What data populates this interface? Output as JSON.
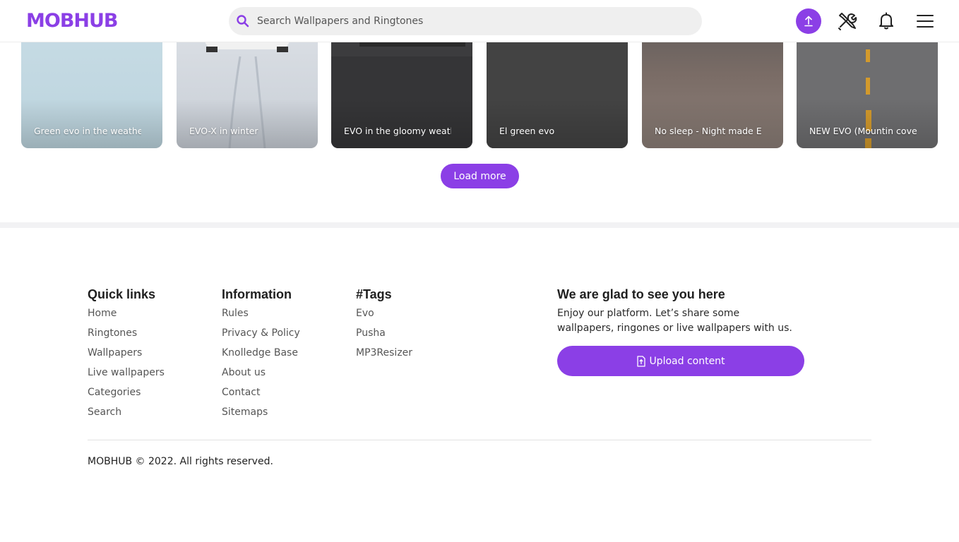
{
  "header": {
    "logo": "MOBHUB",
    "search_placeholder": "Search Wallpapers and Ringtones",
    "icons": [
      "search-icon",
      "upload-icon",
      "tools-icon",
      "bell-icon",
      "menu-icon"
    ]
  },
  "cards": [
    {
      "title": "Green evo in the weather"
    },
    {
      "title": "EVO-X in winter"
    },
    {
      "title": "EVO in the gloomy weather"
    },
    {
      "title": "El green evo"
    },
    {
      "title": "No sleep - Night made EVO"
    },
    {
      "title": "NEW EVO (Mountin cover)"
    }
  ],
  "load_more": "Load more",
  "footer": {
    "quick_links": {
      "heading": "Quick links",
      "items": [
        "Home",
        "Ringtones",
        "Wallpapers",
        "Live wallpapers",
        "Categories",
        "Search"
      ]
    },
    "information": {
      "heading": "Information",
      "items": [
        "Rules",
        "Privacy & Policy",
        "Knolledge Base",
        "About us",
        "Contact",
        "Sitemaps"
      ]
    },
    "tags": {
      "heading": "#Tags",
      "items": [
        "Evo",
        "Pusha",
        "MP3Resizer"
      ]
    },
    "glad": {
      "heading": "We are glad to see you here",
      "text": "Enjoy our platform. Let’s share some wallpapers, ringones or live wallpapers with us.",
      "button": "Upload content"
    },
    "copyright": "MOBHUB © 2022. All rights reserved."
  },
  "colors": {
    "accent": "#8b3fe6",
    "band": "#f2f2f4"
  }
}
